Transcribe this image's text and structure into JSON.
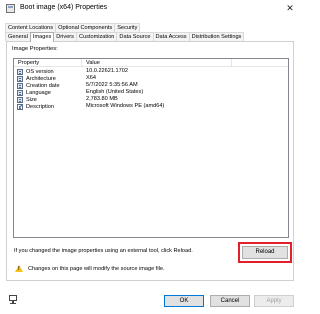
{
  "window": {
    "title": "Boot image (x64) Properties",
    "close_glyph": "✕",
    "icon": "boot-image-icon"
  },
  "tabs": {
    "row1": [
      "Content Locations",
      "Optional Components",
      "Security"
    ],
    "row2": [
      "General",
      "Images",
      "Drivers",
      "Customization",
      "Data Source",
      "Data Access",
      "Distribution Settings"
    ],
    "active": "Images"
  },
  "image_properties": {
    "label": "Image Properties:",
    "columns": [
      "Property",
      "Value"
    ],
    "rows": [
      {
        "property": "OS version",
        "value": "10.0.22621.1702",
        "icon": "property-icon"
      },
      {
        "property": "Architecture",
        "value": "X64",
        "icon": "property-icon"
      },
      {
        "property": "Creation date",
        "value": "5/7/2022 5:35:56 AM",
        "icon": "property-icon"
      },
      {
        "property": "Language",
        "value": "English (United States)",
        "icon": "property-icon"
      },
      {
        "property": "Size",
        "value": "2,783.80 MB",
        "icon": "property-icon"
      },
      {
        "property": "Description",
        "value": "Microsoft Windows PE (amd64)",
        "icon": "edit-property-icon"
      }
    ]
  },
  "reload_hint": "If you changed the image properties using an external tool, click Reload.",
  "reload_label": "Reload",
  "warning": {
    "text": "Changes on this page will modify the source image file.",
    "icon": "warning-icon"
  },
  "footer": {
    "ok_label": "OK",
    "cancel_label": "Cancel",
    "apply_label": "Apply",
    "icon": "computer-icon"
  },
  "colors": {
    "highlight": "#e1212a",
    "warning": "#f3c21b",
    "ok_border": "#0078d7"
  }
}
